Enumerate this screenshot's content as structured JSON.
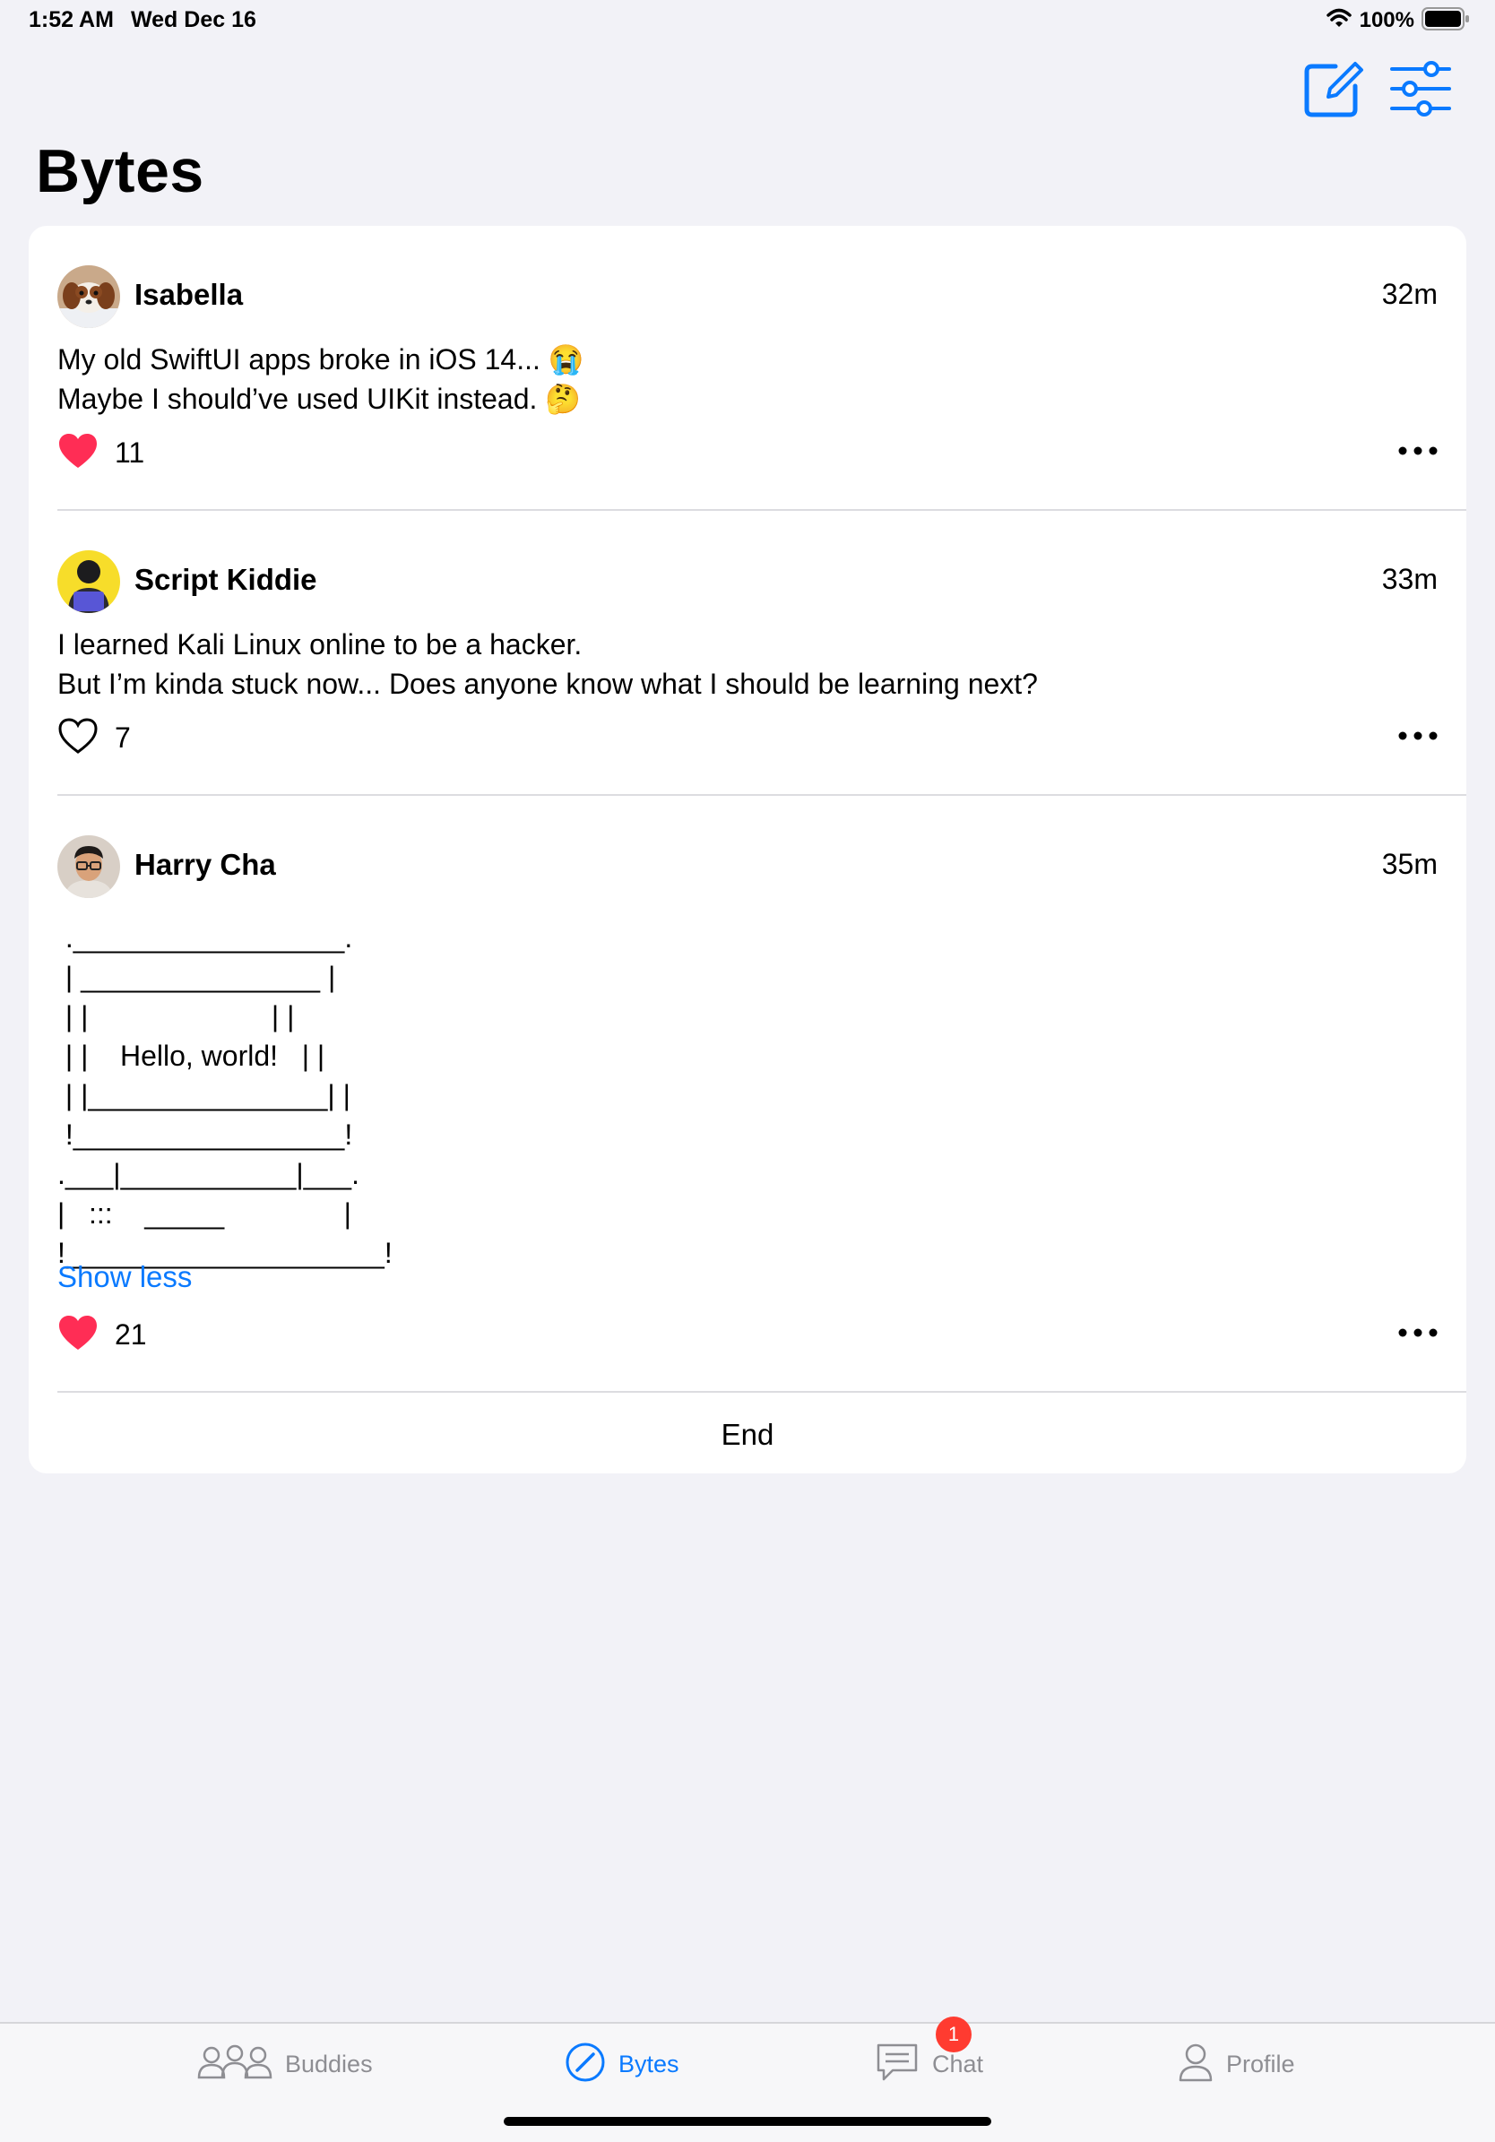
{
  "status": {
    "time": "1:52 AM",
    "date": "Wed Dec 16",
    "battery": "100%"
  },
  "nav": {
    "title": "Bytes",
    "compose_icon": "compose-icon",
    "filter_icon": "sliders-icon"
  },
  "posts": [
    {
      "author": "Isabella",
      "time": "32m",
      "text": "My old SwiftUI apps broke in iOS 14... 😭\nMaybe I should’ve used UIKit instead. 🤔",
      "likes": "11",
      "liked": true,
      "avatar": "puppy-avatar"
    },
    {
      "author": "Script Kiddie",
      "time": "33m",
      "text": "I learned Kali Linux online to be a hacker.\nBut I’m kinda stuck now... Does anyone know what I should be learning next?",
      "likes": "7",
      "liked": false,
      "avatar": "hacker-avatar"
    },
    {
      "author": "Harry Cha",
      "time": "35m",
      "ascii": " ._________________.\n | _______________ |\n | |                       | |\n | |    Hello, world!   | |\n | |_______________| |\n !_________________!\n.___|___________|___.\n|   :::    _____               |\n!____________________!",
      "show_less": "Show less",
      "likes": "21",
      "liked": true,
      "avatar": "person-avatar"
    }
  ],
  "end_label": "End",
  "tabs": [
    {
      "label": "Buddies",
      "icon": "people-icon",
      "active": false
    },
    {
      "label": "Bytes",
      "icon": "compass-icon",
      "active": true
    },
    {
      "label": "Chat",
      "icon": "chat-icon",
      "active": false,
      "badge": "1"
    },
    {
      "label": "Profile",
      "icon": "person-icon",
      "active": false
    }
  ],
  "colors": {
    "accent": "#0a7aff",
    "heart": "#ff2d55",
    "badge": "#ff3b30",
    "background": "#f2f2f7"
  }
}
